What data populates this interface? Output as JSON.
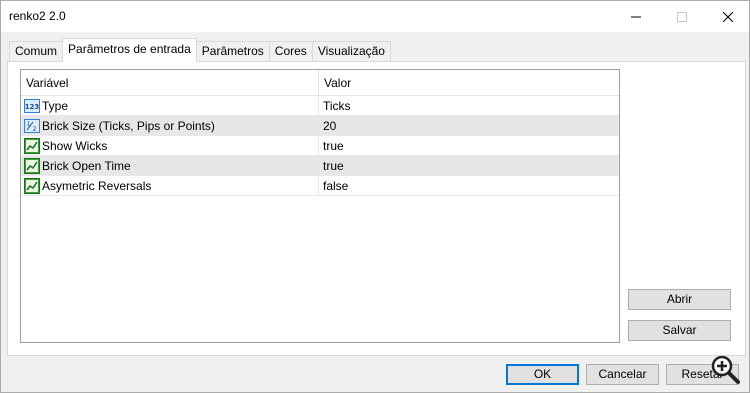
{
  "window": {
    "title": "renko2 2.0"
  },
  "tabs": [
    {
      "label": "Comum",
      "active": false
    },
    {
      "label": "Parâmetros de entrada",
      "active": true
    },
    {
      "label": "Parâmetros",
      "active": false
    },
    {
      "label": "Cores",
      "active": false
    },
    {
      "label": "Visualização",
      "active": false
    }
  ],
  "grid": {
    "header": {
      "variable": "Variável",
      "value": "Valor"
    },
    "rows": [
      {
        "icon": "enum-123-icon",
        "variable": "Type",
        "value": "Ticks"
      },
      {
        "icon": "fraction-icon",
        "variable": "Brick Size (Ticks, Pips or Points)",
        "value": "20"
      },
      {
        "icon": "bool-chart-icon",
        "variable": "Show Wicks",
        "value": "true"
      },
      {
        "icon": "bool-chart-icon",
        "variable": "Brick Open Time",
        "value": "true"
      },
      {
        "icon": "bool-chart-icon",
        "variable": "Asymetric Reversals",
        "value": "false"
      }
    ]
  },
  "side_buttons": {
    "open_label": "Abrir",
    "save_label": "Salvar"
  },
  "footer": {
    "ok_label": "OK",
    "cancel_label": "Cancelar",
    "reset_label": "Resetar"
  }
}
